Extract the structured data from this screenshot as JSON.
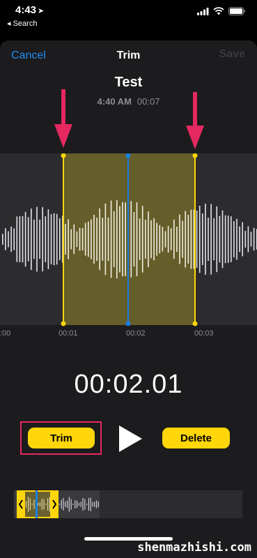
{
  "status_bar": {
    "time": "4:43",
    "back_label": "◂ Search"
  },
  "nav": {
    "cancel": "Cancel",
    "title": "Trim",
    "save": "Save"
  },
  "recording": {
    "name": "Test",
    "time": "4:40 AM",
    "duration": "00:07"
  },
  "timeline_labels": [
    ":00",
    "00:01",
    "00:02",
    "00:03"
  ],
  "counter": "00:02.01",
  "controls": {
    "trim_label": "Trim",
    "delete_label": "Delete"
  },
  "watermark": "shenmazhishi.com",
  "colors": {
    "accent_blue": "#1f8cf0",
    "trim_yellow": "#ffd60a",
    "annotation_pink": "#e5285f",
    "playhead_blue": "#1a7fe0"
  },
  "icons": [
    "location-arrow-icon",
    "cellular-signal-icon",
    "wifi-icon",
    "battery-icon",
    "play-icon",
    "chevron-left-icon",
    "chevron-right-icon"
  ]
}
